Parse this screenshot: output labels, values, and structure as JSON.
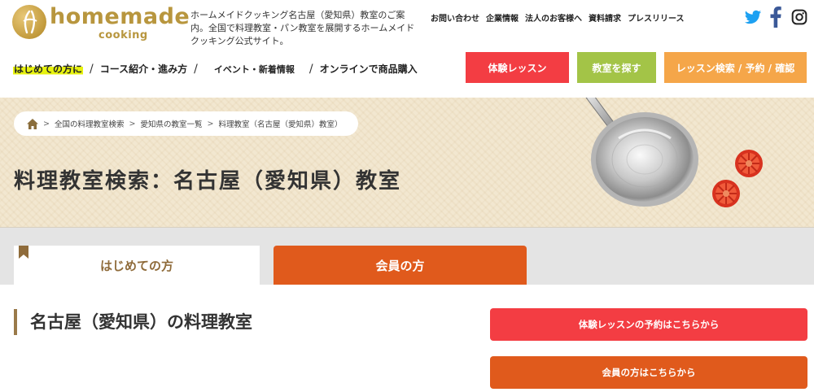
{
  "brand": {
    "logo_word": "homemade",
    "logo_sub": "cooking",
    "tagline": "ホームメイドクッキング名古屋（愛知県）教室のご案内。全国で料理教室・パン教室を展開するホームメイドクッキング公式サイト。"
  },
  "utility_links": [
    "お問い合わせ",
    "企業情報",
    "法人のお客様へ",
    "資料請求",
    "プレスリリース"
  ],
  "social": [
    "twitter-icon",
    "facebook-icon",
    "instagram-icon"
  ],
  "nav": {
    "first_timer": "はじめての方に",
    "courses": "コース紹介・進み方",
    "events": "イベント・新着情報",
    "online_shop": "オンラインで商品購入",
    "separator": "/"
  },
  "header_buttons": {
    "trial": "体験レッスン",
    "find_school": "教室を探す",
    "search_reserve": "レッスン検索 / 予約 / 確認"
  },
  "breadcrumb": {
    "items": [
      "全国の料理教室検索",
      "愛知県の教室一覧",
      "料理教室（名古屋（愛知県）教室）"
    ],
    "arrow": ">"
  },
  "hero": {
    "title": "料理教室検索：名古屋（愛知県）教室"
  },
  "tabs": {
    "first_time": "はじめての方",
    "members": "会員の方"
  },
  "main": {
    "section_title": "名古屋（愛知県）の料理教室",
    "cta_trial": "体験レッスンの予約はこちらから",
    "cta_member": "会員の方はこちらから"
  },
  "colors": {
    "brand_gold": "#b8963e",
    "trial_red": "#f33d43",
    "find_green": "#a3c447",
    "search_orange": "#f5a649",
    "member_orange": "#e05a1c",
    "highlight_yellow": "#e7f20e"
  }
}
